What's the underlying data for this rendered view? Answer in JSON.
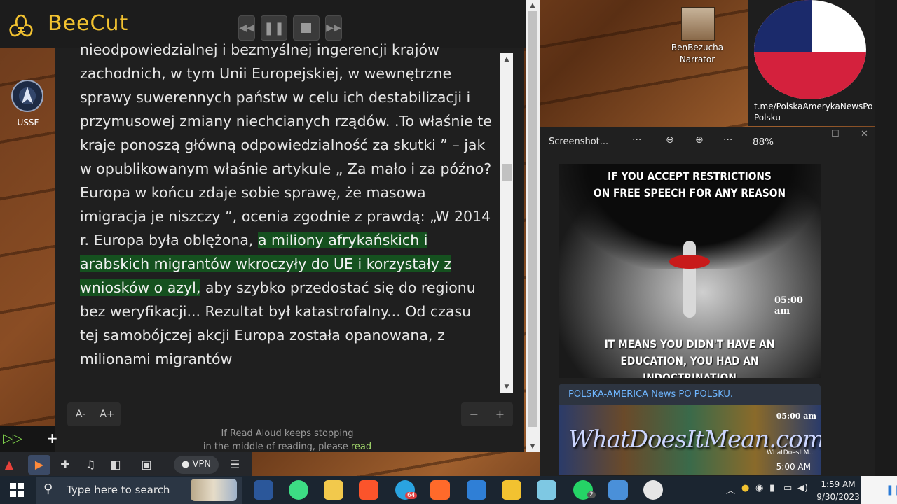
{
  "beecut": {
    "name": "BeeCut"
  },
  "desktop": {
    "ussf_label": "USSF"
  },
  "reader": {
    "paragraph_before": "nieodpowiedzialnej i bezmyślnej ingerencji krajów zachodnich, w tym Unii Europejskiej, w wewnętrzne sprawy suwerennych państw w celu ich destabilizacji i przymusowej zmiany niechcianych rządów. .To właśnie te kraje ponoszą główną odpowiedzialność za skutki ” – jak w opublikowanym właśnie artykule „ Za mało i za późno?Europa w końcu zdaje sobie sprawę, że masowa imigracja je niszczy ”, ocenia zgodnie z prawdą: „W 2014 r. Europa była oblężona, ",
    "highlight": "a miliony afrykańskich i arabskich migrantów wkroczyły do UE i korzystały z wniosków o azyl,",
    "paragraph_after": " aby szybko przedostać się do regionu bez weryfikacji... Rezultat był katastrofalny... Od czasu tej samobójczej akcji Europa została opanowana, z milionami migrantów",
    "font_decrease": "A-",
    "font_increase": "A+",
    "zoom_out": "−",
    "zoom_in": "+",
    "footer_line1": "If Read Aloud keeps stopping",
    "footer_line2": "in the middle of reading, please ",
    "footer_link": "read"
  },
  "toolbar2": {
    "vpn": "VPN"
  },
  "profile": {
    "name_line1": "BenBezucha",
    "name_line2": "Narrator"
  },
  "channel_link": {
    "line1": "t.me/PolskaAmerykaNewsPo",
    "line2": "Polsku"
  },
  "viewer": {
    "title": "Screenshot...",
    "more1": "···",
    "more2": "···",
    "zoom": "88%",
    "meme_top_line1": "IF YOU ACCEPT RESTRICTIONS",
    "meme_top_line2": "ON FREE SPEECH FOR ANY REASON",
    "meme_time": "05:00 am",
    "meme_bottom_line1": "IT MEANS YOU DIDN'T HAVE AN",
    "meme_bottom_line2": "EDUCATION, YOU HAD AN INDOCTRINATION",
    "channel_name": "POLSKA-AMERICA News PO POLSKU.",
    "thumb_time_top": "05:00 am",
    "thumb_site": "WhatDoesItMean.com",
    "thumb_small": "WhatDoesItM...",
    "thumb_time_bottom": "5:00 AM"
  },
  "taskbar": {
    "search_placeholder": "Type here to search",
    "telegram_badge": "64",
    "whatsapp_badge": "2",
    "time": "1:59 AM",
    "date": "9/30/2023"
  },
  "colors": {
    "highlight_bg": "#15511f",
    "beecut_yellow": "#f2c230",
    "link_green": "#9fd36a"
  }
}
